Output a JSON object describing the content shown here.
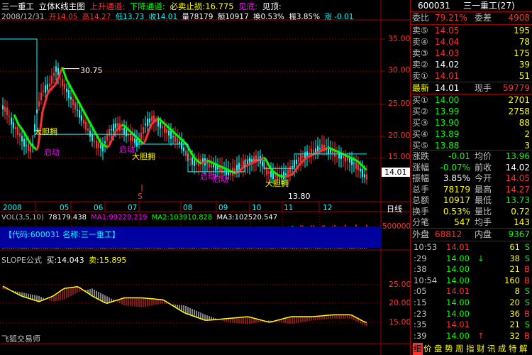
{
  "header": {
    "stock_name": "三一重工",
    "chart_title": "立体K线主图",
    "up_channel_label": "上升通道:",
    "down_channel_label": "下降通道:",
    "stop_loss_label": "必卖止损:16.775",
    "see_top_label": "见底:",
    "see_top2_label": "见顶:"
  },
  "ohlc": {
    "date": "2008/12/31",
    "open": "开14.05",
    "high": "高14.27",
    "low": "低13.73",
    "close": "收14.01",
    "volume": "量78179",
    "amount": "额10917",
    "turnover": "换0.53%",
    "amplitude": "振3.85%",
    "change": "涨 -0.01"
  },
  "price_axis": [
    "35.00",
    "30.00",
    "25.00",
    "20.00",
    "15.00"
  ],
  "current_price_tag": "14.01",
  "annotations": {
    "peak": "30.75",
    "low": "13.80",
    "big_bet_1": "大胆拥",
    "big_bet_2": "大胆拥",
    "big_bet_3": "大胆拥",
    "start_1": "启动",
    "start_2": "启动",
    "start_3": "启动",
    "start_4": "启动",
    "s_marker": "S"
  },
  "date_axis": [
    "2008",
    "05",
    "06",
    "07",
    "08",
    "09",
    "10",
    "11",
    "12"
  ],
  "period_label": "日线",
  "volume_panel": {
    "header": "VOL(3,5,10)",
    "vol": "78179.438",
    "ma1": "MA1:99229.219",
    "ma2": "MA2:103910.828",
    "ma3": "MA3:102520.547",
    "info_banner": "【代码:600031 名称:三一重工】",
    "axis_label": "500000"
  },
  "slope_panel": {
    "header": "SLOPE公式",
    "buy": "买:14.043",
    "sell": "卖:15.895",
    "axis": [
      "25.00",
      "20.00",
      "15.00"
    ],
    "watermark": "飞狐交易师"
  },
  "quote": {
    "code": "600031",
    "name": "三一重工(27)",
    "wei_bi_label": "委比",
    "wei_bi": "79.21%",
    "wei_cha_label": "委差",
    "wei_cha": "4908",
    "sells": [
      {
        "label": "卖⑤",
        "price": "14.05",
        "vol": "195"
      },
      {
        "label": "卖④",
        "price": "14.04",
        "vol": "78"
      },
      {
        "label": "卖③",
        "price": "14.03",
        "vol": "175"
      },
      {
        "label": "卖②",
        "price": "14.02",
        "vol": "39"
      },
      {
        "label": "卖①",
        "price": "14.01",
        "vol": "51"
      }
    ],
    "last_label": "最新",
    "last": "14.01",
    "current_label": "现手",
    "current": "59779",
    "buys": [
      {
        "label": "买①",
        "price": "14.00",
        "vol": "2701"
      },
      {
        "label": "买②",
        "price": "13.99",
        "vol": "2758"
      },
      {
        "label": "买③",
        "price": "13.90",
        "vol": "88"
      },
      {
        "label": "买④",
        "price": "13.89",
        "vol": "2"
      },
      {
        "label": "买⑤",
        "price": "13.88",
        "vol": "3"
      }
    ],
    "stats": [
      {
        "l1": "涨跌",
        "v1": "-0.01",
        "l2": "均价",
        "v2": "13.96"
      },
      {
        "l1": "涨幅",
        "v1": "-0.07%",
        "l2": "前收",
        "v2": "14.02"
      },
      {
        "l1": "振幅",
        "v1": "3.85%",
        "l2": "今开",
        "v2": "14.05"
      },
      {
        "l1": "总手",
        "v1": "78179",
        "l2": "最高",
        "v2": "14.27"
      },
      {
        "l1": "总额",
        "v1": "10917",
        "l2": "最低",
        "v2": "13.73"
      },
      {
        "l1": "换手",
        "v1": "0.53%",
        "l2": "量比",
        "v2": "0.72"
      },
      {
        "l1": "分笔",
        "v1": "547",
        "l2": "均手",
        "v2": "143"
      }
    ],
    "outer_label": "外盘",
    "outer": "68812",
    "inner_label": "内盘",
    "inner": "9367"
  },
  "ticks": [
    {
      "time": "10:53",
      "price": "14.01",
      "vol": "61",
      "side": "S",
      "arrow": ""
    },
    {
      "time": ":29",
      "price": "14.00",
      "vol": "38",
      "side": "S",
      "arrow": "↓"
    },
    {
      "time": ":38",
      "price": "14.00",
      "vol": "21",
      "side": "B",
      "arrow": ""
    },
    {
      "time": "10:54",
      "price": "14.00",
      "vol": "160",
      "side": "B",
      "arrow": ""
    },
    {
      "time": ":05",
      "price": "14.01",
      "vol": "8",
      "side": "S",
      "arrow": ""
    },
    {
      "time": ":15",
      "price": "14.00",
      "vol": "20",
      "side": "S",
      "arrow": ""
    },
    {
      "time": ":23",
      "price": "14.00",
      "vol": "36",
      "side": "B",
      "arrow": ""
    },
    {
      "time": ":35",
      "price": "14.01",
      "vol": "21",
      "side": "S",
      "arrow": ""
    },
    {
      "time": ":39",
      "price": "14.00",
      "vol": "32",
      "side": "B",
      "arrow": "↑"
    }
  ],
  "footer_tabs": [
    "细",
    "价",
    "盘",
    "势",
    "周",
    "指",
    "财",
    "讯",
    "成",
    "特",
    "解"
  ],
  "colors": {
    "red": "#ff3030",
    "green": "#00ff00",
    "yellow": "#ffff00",
    "cyan": "#00ffff",
    "magenta": "#ff00ff",
    "grid": "#a00000",
    "banner": "#0000a0"
  }
}
